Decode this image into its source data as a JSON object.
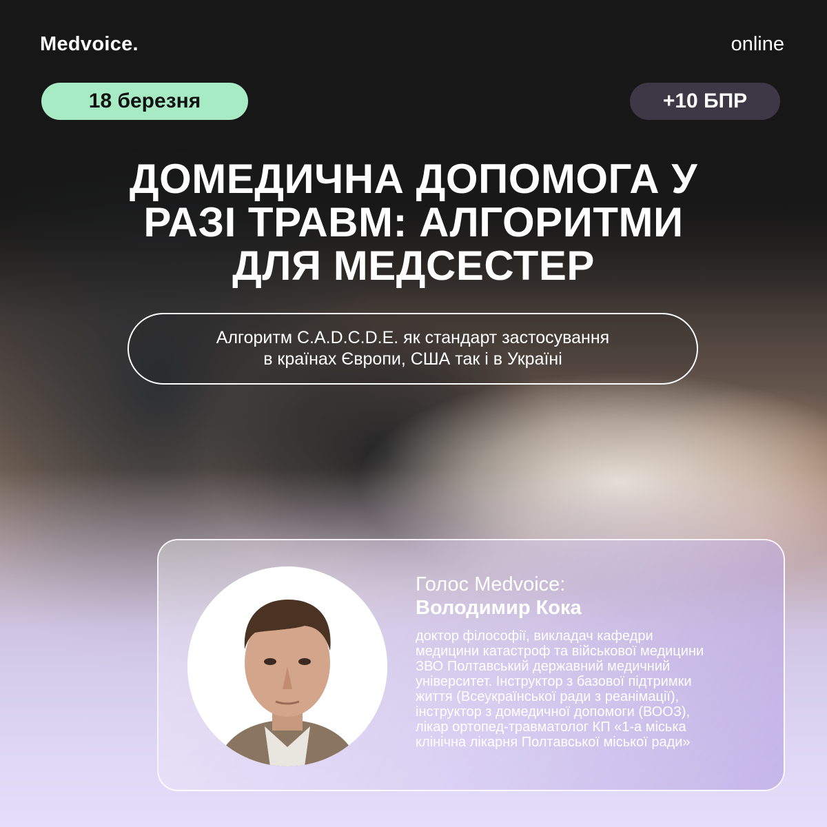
{
  "brand": {
    "logo": "Medvoice.",
    "mode": "online"
  },
  "badges": {
    "date": "18 березня",
    "points": "+10 БПР"
  },
  "title_lines": [
    "ДОМЕДИЧНА ДОПОМОГА У",
    "РАЗІ ТРАВМ: АЛГОРИТМИ",
    "ДЛЯ МЕДСЕСТЕР"
  ],
  "subtitle_lines": [
    "Алгоритм C.A.D.C.D.E. як стандарт застосування",
    "в країнах Європи, США так і в Україні"
  ],
  "speaker": {
    "role": "Голос Medvoice:",
    "name": "Володимир Кока",
    "bio_lines": [
      "доктор філософії, викладач кафедри",
      "медицини катастроф та військової медицини",
      "ЗВО Полтавський державний медичний",
      "університет. Інструктор з базової підтримки",
      "життя (Всеукраїнської ради з реанімації),",
      "інструктор з домедичної допомоги (ВООЗ),",
      "лікар ортопед-травматолог КП «1-а міська",
      "клінічна лікарня Полтавської міської ради»"
    ]
  },
  "colors": {
    "date_badge": "#a6ebc3",
    "points_badge": "#3d3846",
    "card_tint": "#b29ede",
    "background_dark": "#171717",
    "background_light": "#e4defa"
  }
}
